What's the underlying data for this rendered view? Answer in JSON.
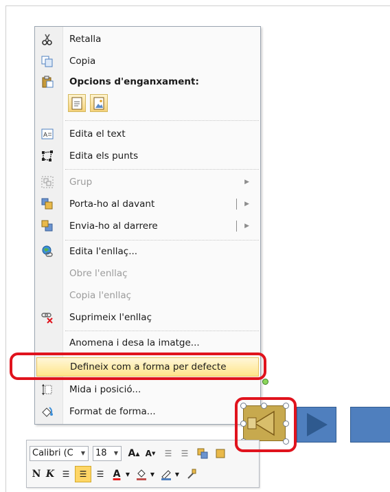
{
  "menu": {
    "items": [
      {
        "id": "retalla",
        "label": "Retalla",
        "icon": "scissors-icon",
        "enabled": true
      },
      {
        "id": "copia",
        "label": "Copia",
        "icon": "copy-icon",
        "enabled": true
      },
      {
        "id": "opcions",
        "label": "Opcions d'enganxament:",
        "icon": "paste-icon",
        "enabled": true
      },
      {
        "id": "edita-text",
        "label": "Edita el text",
        "icon": "text-box-icon",
        "enabled": true
      },
      {
        "id": "edita-punts",
        "label": "Edita els punts",
        "icon": "edit-points-icon",
        "enabled": true
      },
      {
        "id": "grup",
        "label": "Grup",
        "icon": "group-icon",
        "enabled": false
      },
      {
        "id": "porta",
        "label": "Porta-ho al davant",
        "icon": "bring-forward-icon",
        "enabled": true
      },
      {
        "id": "envia",
        "label": "Envia-ho al darrere",
        "icon": "send-backward-icon",
        "enabled": true
      },
      {
        "id": "edita-enllac",
        "label": "Edita l'enllaç...",
        "icon": "hyperlink-globe-icon",
        "enabled": true
      },
      {
        "id": "obre-enllac",
        "label": "Obre l'enllaç",
        "icon": "",
        "enabled": false
      },
      {
        "id": "copia-enllac",
        "label": "Copia l'enllaç",
        "icon": "",
        "enabled": false
      },
      {
        "id": "suprimeix-enllac",
        "label": "Suprimeix l'enllaç",
        "icon": "remove-link-icon",
        "enabled": true
      },
      {
        "id": "anomena",
        "label": "Anomena i desa la imatge...",
        "icon": "",
        "enabled": true
      },
      {
        "id": "defineix",
        "label": "Defineix com a forma per defecte",
        "icon": "",
        "enabled": true,
        "highlighted": true
      },
      {
        "id": "mida",
        "label": "Mida i posició...",
        "icon": "size-position-icon",
        "enabled": true
      },
      {
        "id": "format",
        "label": "Format de forma...",
        "icon": "format-shape-icon",
        "enabled": true
      }
    ]
  },
  "mini_toolbar": {
    "font": "Calibri (C",
    "size": "18",
    "bold": "N",
    "italic": "K",
    "font_color": "#e81c1c",
    "fill_color": "#c0504d"
  },
  "colors": {
    "accent_red": "#e0131d",
    "shape_gold": "#c7a94e",
    "shape_blue": "#4f7fbe"
  }
}
